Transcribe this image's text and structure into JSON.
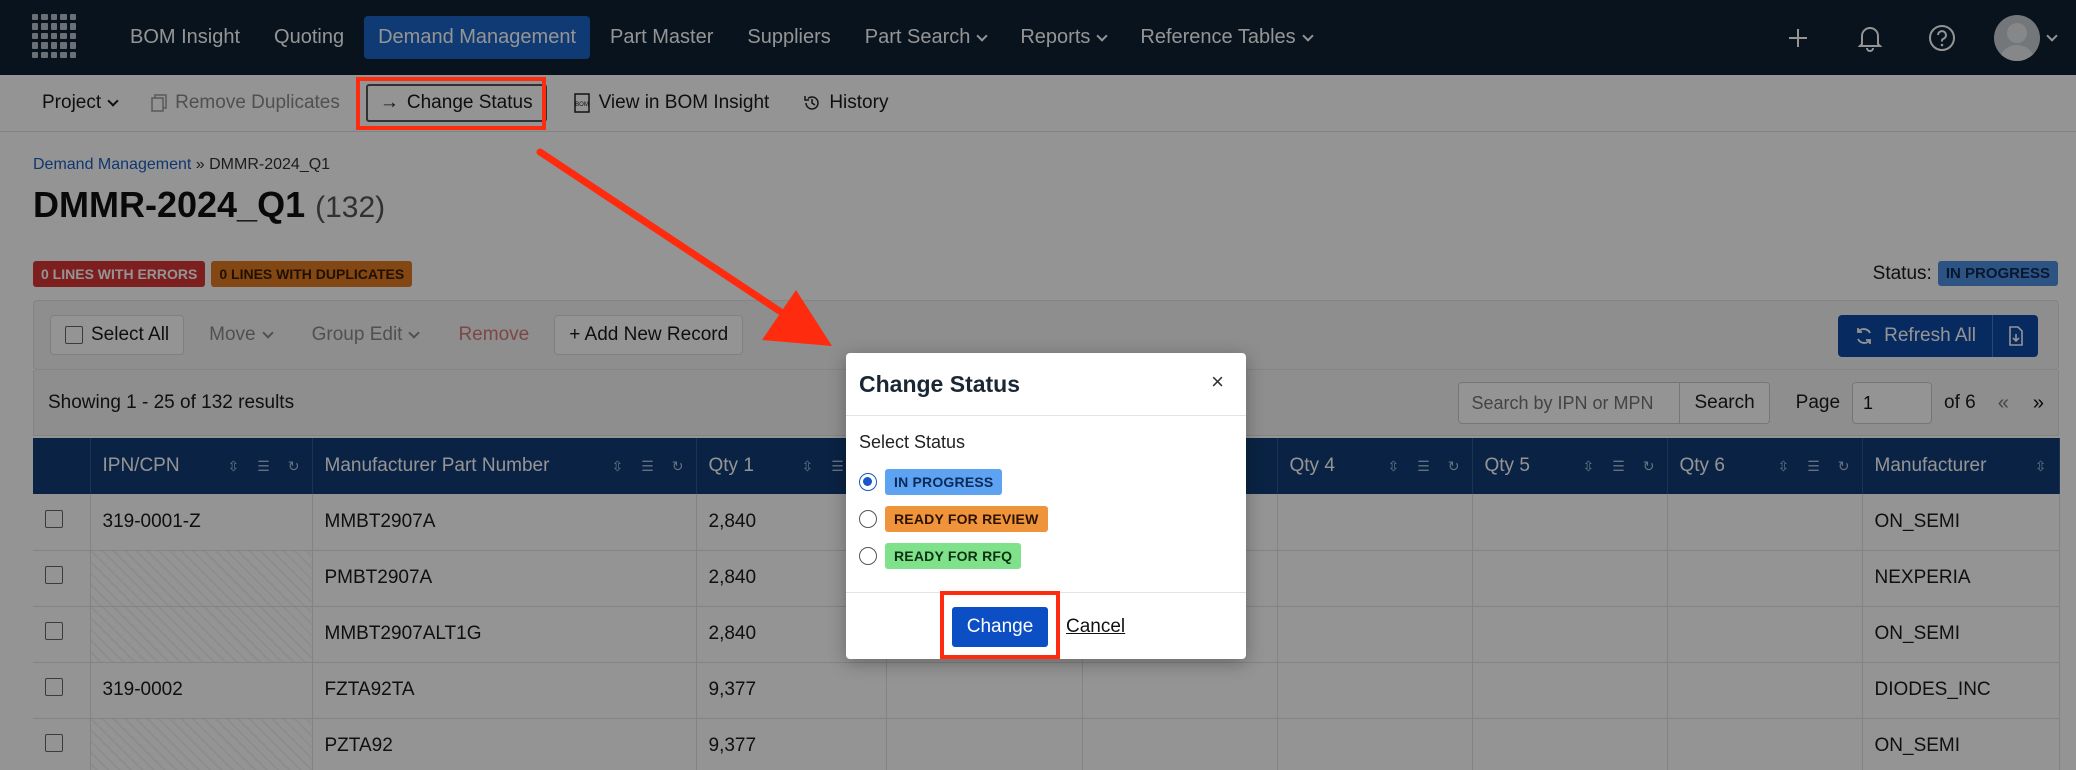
{
  "nav": {
    "items": [
      {
        "label": "BOM Insight",
        "dropdown": false,
        "active": false
      },
      {
        "label": "Quoting",
        "dropdown": false,
        "active": false
      },
      {
        "label": "Demand Management",
        "dropdown": false,
        "active": true
      },
      {
        "label": "Part Master",
        "dropdown": false,
        "active": false
      },
      {
        "label": "Suppliers",
        "dropdown": false,
        "active": false
      },
      {
        "label": "Part Search",
        "dropdown": true,
        "active": false
      },
      {
        "label": "Reports",
        "dropdown": true,
        "active": false
      },
      {
        "label": "Reference Tables",
        "dropdown": true,
        "active": false
      }
    ],
    "icons": [
      "plus-icon",
      "bell-icon",
      "help-icon",
      "avatar"
    ]
  },
  "toolbar": {
    "project": "Project",
    "remove_duplicates": "Remove Duplicates",
    "change_status": "Change Status",
    "view_in_bom": "View in BOM Insight",
    "history": "History"
  },
  "breadcrumb": {
    "parent": "Demand Management",
    "separator": "»",
    "current": "DMMR-2024_Q1"
  },
  "page": {
    "title": "DMMR-2024_Q1",
    "count": "(132)"
  },
  "badges": {
    "errors": "0 LINES WITH ERRORS",
    "duplicates": "0 LINES WITH DUPLICATES"
  },
  "status": {
    "label": "Status:",
    "value": "IN PROGRESS"
  },
  "actions": {
    "select_all": "Select All",
    "move": "Move",
    "group_edit": "Group Edit",
    "remove": "Remove",
    "add_record": "+ Add New Record",
    "refresh_all": "Refresh All"
  },
  "results": {
    "showing": "Showing 1 - 25 of 132 results",
    "search_placeholder": "Search by IPN or MPN",
    "search_button": "Search",
    "page_label": "Page",
    "page_value": "1",
    "of_pages": "of 6",
    "prev": "«",
    "next": "»"
  },
  "table": {
    "columns": [
      "IPN/CPN",
      "Manufacturer Part Number",
      "Qty 1",
      "",
      "",
      "Qty 4",
      "Qty 5",
      "Qty 6",
      "Manufacturer"
    ],
    "rows": [
      {
        "ipn": "319-0001-Z",
        "mpn": "MMBT2907A",
        "qty1": "2,840",
        "mfr": "ON_SEMI"
      },
      {
        "ipn": "",
        "mpn": "PMBT2907A",
        "qty1": "2,840",
        "mfr": "NEXPERIA"
      },
      {
        "ipn": "",
        "mpn": "MMBT2907ALT1G",
        "qty1": "2,840",
        "mfr": "ON_SEMI"
      },
      {
        "ipn": "319-0002",
        "mpn": "FZTA92TA",
        "qty1": "9,377",
        "mfr": "DIODES_INC"
      },
      {
        "ipn": "",
        "mpn": "PZTA92",
        "qty1": "9,377",
        "mfr": "ON_SEMI"
      }
    ]
  },
  "modal": {
    "title": "Change Status",
    "close": "×",
    "select_label": "Select Status",
    "options": [
      {
        "label": "IN PROGRESS",
        "color": "#5ea2f2",
        "selected": true
      },
      {
        "label": "READY FOR REVIEW",
        "color": "#f0943c",
        "selected": false
      },
      {
        "label": "READY FOR RFQ",
        "color": "#7fe28a",
        "selected": false
      }
    ],
    "change": "Change",
    "cancel": "Cancel"
  },
  "colors": {
    "nav_bg": "#0e2233",
    "accent": "#1b64c9",
    "annotation_red": "#ff2b0e",
    "errors_badge": "#d93636",
    "duplicates_badge": "#e07a22"
  }
}
